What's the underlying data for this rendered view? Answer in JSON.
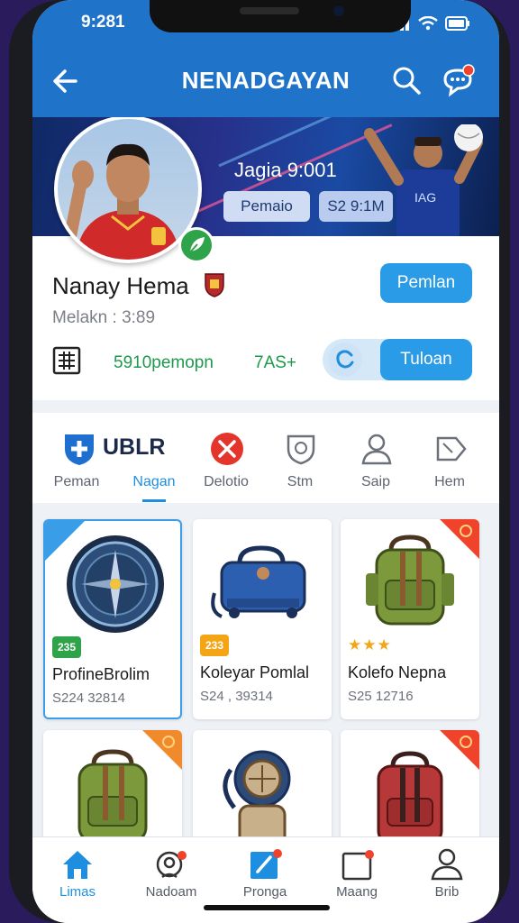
{
  "status": {
    "time": "9:281"
  },
  "header": {
    "title": "NENADGAYAN"
  },
  "banner": {
    "role": "Jagia 9:001",
    "pill_left": "Pemaio",
    "pill_right": "S2 9:1M"
  },
  "profile": {
    "name": "Nanay Hema",
    "subtitle": "Melakn : 3:89",
    "follow_label": "Pemlan",
    "stat1": "5910pemopn",
    "stat2": "7AS+",
    "action_label": "Tuloan"
  },
  "categories": {
    "brand": "UBLR",
    "items": [
      {
        "label": "Peman",
        "icon": "shield-plus-icon"
      },
      {
        "label": "Nagan",
        "icon": "none"
      },
      {
        "label": "Delotio",
        "icon": "close-circle-icon"
      },
      {
        "label": "Stm",
        "icon": "shield-icon"
      },
      {
        "label": "Saip",
        "icon": "user-icon"
      },
      {
        "label": "Hem",
        "icon": "tag-icon"
      }
    ],
    "active_index": 1
  },
  "products": [
    {
      "title": "ProfineBrolim",
      "price": "S224 32814",
      "badge": "235",
      "badge_color": "#2ea34a",
      "item": "compass"
    },
    {
      "title": "Koleyar Pomlal",
      "price": "S24 , 39314",
      "badge": "233",
      "badge_color": "#f4a516",
      "item": "blue-bag"
    },
    {
      "title": "Kolefo  Nepna",
      "price": "S25 12716",
      "badge": "★★★",
      "badge_color": "#f4a516",
      "item": "green-backpack"
    },
    {
      "title": "",
      "price": "",
      "badge": "",
      "badge_color": "",
      "item": "green-backpack"
    },
    {
      "title": "",
      "price": "",
      "badge": "",
      "badge_color": "",
      "item": "diver"
    },
    {
      "title": "",
      "price": "",
      "badge": "",
      "badge_color": "",
      "item": "red-backpack"
    }
  ],
  "nav": {
    "items": [
      {
        "label": "Limas",
        "icon": "home-icon"
      },
      {
        "label": "Nadoam",
        "icon": "support-icon"
      },
      {
        "label": "Pronga",
        "icon": "edit-icon"
      },
      {
        "label": "Maang",
        "icon": "bag-icon"
      },
      {
        "label": "Brib",
        "icon": "user-icon"
      }
    ],
    "active_index": 0
  },
  "colors": {
    "primary": "#1f74c9",
    "accent": "#2a9be6",
    "green": "#1d9a4c"
  }
}
